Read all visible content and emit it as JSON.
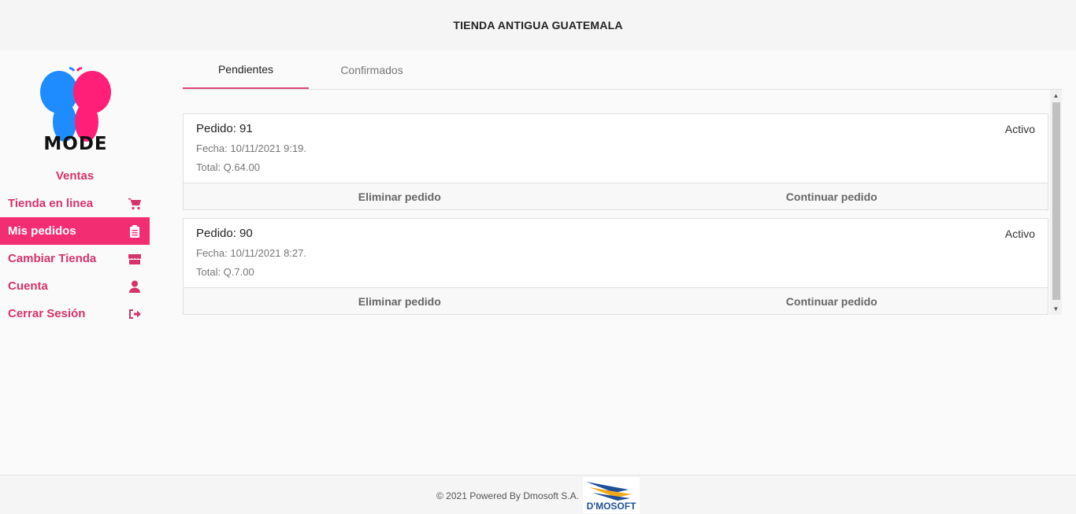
{
  "header": {
    "title": "TIENDA ANTIGUA GUATEMALA"
  },
  "brand": {
    "logo_text": "MODE",
    "logo_icon": "butterfly-logo"
  },
  "sidebar": {
    "section_label": "Ventas",
    "items": [
      {
        "label": "Tienda en linea",
        "icon": "cart-icon",
        "active": false
      },
      {
        "label": "Mis pedidos",
        "icon": "clipboard-icon",
        "active": true
      },
      {
        "label": "Cambiar Tienda",
        "icon": "store-icon",
        "active": false
      },
      {
        "label": "Cuenta",
        "icon": "user-icon",
        "active": false
      },
      {
        "label": "Cerrar Sesión",
        "icon": "logout-icon",
        "active": false
      }
    ]
  },
  "tabs": [
    {
      "label": "Pendientes",
      "active": true
    },
    {
      "label": "Confirmados",
      "active": false
    }
  ],
  "orders": [
    {
      "title": "Pedido: 91",
      "status": "Activo",
      "date": "Fecha: 10/11/2021 9:19.",
      "total": "Total: Q.64.00",
      "delete_label": "Eliminar pedido",
      "continue_label": "Continuar pedido"
    },
    {
      "title": "Pedido: 90",
      "status": "Activo",
      "date": "Fecha: 10/11/2021 8:27.",
      "total": "Total: Q.7.00",
      "delete_label": "Eliminar pedido",
      "continue_label": "Continuar pedido"
    }
  ],
  "footer": {
    "copyright": "© 2021 Powered By Dmosoft S.A.",
    "logo_text": "D'MOSOFT"
  },
  "colors": {
    "accent": "#f32d72",
    "accent_text": "#d6336c",
    "logo_blue": "#1e8cff",
    "logo_pink": "#ff1e78"
  }
}
